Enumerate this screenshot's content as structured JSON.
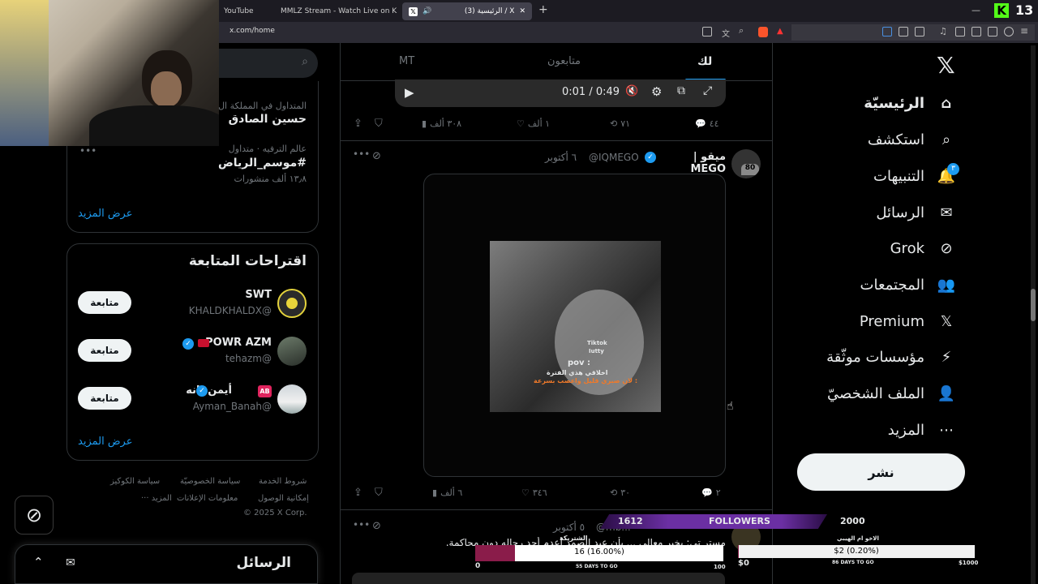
{
  "browser": {
    "tabs": [
      {
        "label": "YouTube"
      },
      {
        "label": "MMLZ Stream - Watch Live on Kick"
      },
      {
        "label": "(3) الرئيسية / X"
      }
    ],
    "new_tab": "+",
    "url": "x.com/home",
    "kick_count": "13"
  },
  "trends": [
    {
      "context": "المتداول في المملكة ال",
      "title": "حسين الصادق"
    },
    {
      "context": "عالم الترفيه · متداول",
      "title": "#موسم_الرياض",
      "count": "١٣٫٨ ألف منشورات"
    }
  ],
  "show_more": "عرض المزيد",
  "suggestions": {
    "title": "اقتراحات المتابعة",
    "users": [
      {
        "name": "SWT",
        "handle": "@KHALDKHALDX",
        "button": "متابعة"
      },
      {
        "name": "POWR AZM",
        "handle": "@tehazm",
        "button": "متابعة"
      },
      {
        "name": "أيمن بانه",
        "badge": "AB",
        "handle": "@Ayman_Banah",
        "button": "متابعة"
      }
    ],
    "show_more": "عرض المزيد"
  },
  "footer": {
    "links": [
      "شروط الخدمة",
      "سياسة الخصوصيّة",
      "سياسة الكوكيز",
      "إمكانية الوصول",
      "معلومات الإعلانات",
      "··· المزيد"
    ],
    "copyright": "© 2025 X Corp."
  },
  "messages": {
    "title": "الرسائل"
  },
  "feed": {
    "tabs": {
      "for_you": "لك",
      "following": "متابعون",
      "extra": "MT"
    },
    "video": {
      "time": "0:01 / 0:49"
    },
    "post1_actions": {
      "replies": "٤٤",
      "reposts": "٧١",
      "likes": "١ ألف",
      "views": "٣٠٨ ألف"
    },
    "post2": {
      "name": "ميقو | MEGO",
      "handle": "@IQMEGO",
      "date": "٦ أكتوبر",
      "overlay_lines": [
        "Tiktok",
        "Iutty",
        "pov :",
        "اخلاقي هذي الفترة",
        "لان صبري قليل واعصب بسرعة :"
      ],
      "actions": {
        "replies": "٢",
        "reposts": "٣٠",
        "likes": "٣٤٦",
        "views": "٦ ألف"
      }
    },
    "post3": {
      "handle_part": "@mb...",
      "date": "٥ أكتوبر",
      "text": "مستر تي: بخير معالي ... بأن عبد الصمد أعدم أحد رجاله دون محاكمة."
    }
  },
  "nav": {
    "items": [
      {
        "label": "الرئيسيّة"
      },
      {
        "label": "استكشف"
      },
      {
        "label": "التنبيهات",
        "badge": "٣"
      },
      {
        "label": "الرسائل"
      },
      {
        "label": "Grok"
      },
      {
        "label": "المجتمعات"
      },
      {
        "label": "Premium"
      },
      {
        "label": "مؤسسات موثّقة"
      },
      {
        "label": "الملف الشخصيّ"
      },
      {
        "label": "المزيد"
      }
    ],
    "post_button": "نشر"
  },
  "stream_overlay": {
    "followers_current": "1612",
    "followers_label": "FOLLOWERS",
    "followers_goal": "2000",
    "sub_goal": {
      "title": "الشتريكة",
      "value": "16 (16.00%)",
      "progress": 0.16,
      "min": "0",
      "max": "100",
      "days": "55 DAYS TO GO"
    },
    "tip_goal": {
      "title": "الاخو ام الهيبي",
      "value": "$2 (0.20%)",
      "progress": 0.002,
      "min": "$0",
      "max": "$1000",
      "days": "86 DAYS TO GO"
    }
  },
  "colors": {
    "accent": "#1d9bf0",
    "background": "#000000",
    "border": "#2f3336",
    "kick_green": "#53fc18",
    "purple": "#6b2fa3"
  }
}
